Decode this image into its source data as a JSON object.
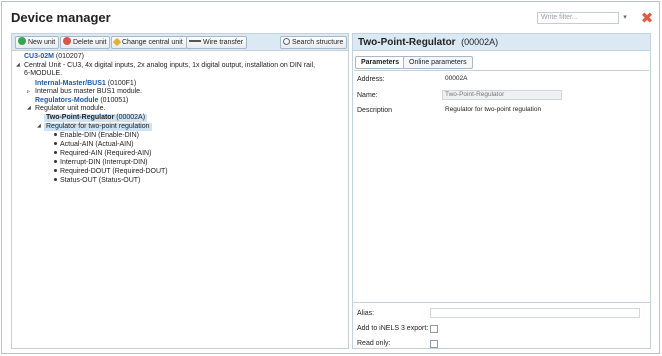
{
  "window": {
    "title": "Device manager",
    "filter_placeholder": "Write filter...",
    "filter_dropdown_icon": "chevron-down-icon",
    "close_icon": "close-icon",
    "close_glyph": "✖"
  },
  "toolbar": {
    "new_unit": "New unit",
    "delete_unit": "Delete unit",
    "change_central_unit": "Change central unit",
    "wire_transfer": "Wire transfer",
    "search_structure": "Search structure"
  },
  "tree": {
    "root": {
      "name": "CU3-02M",
      "code": "(010207)"
    },
    "root_desc_line1": "Central Unit - CU3, 4x digital inputs, 2x analog inputs, 1x digital output, installation on DIN rail,",
    "root_desc_line2": "6-MODULE.",
    "bus": {
      "name": "Internal-Master/BUS1",
      "code": "(0100F1)",
      "desc": "Internal bus master BUS1 module."
    },
    "module": {
      "name": "Regulators-Module",
      "code": "(010051)",
      "desc": "Regulator unit module."
    },
    "regulator": {
      "name": "Two-Point-Regulator",
      "code": "(00002A)",
      "desc": "Regulator for two-point regulation"
    },
    "signals": [
      "Enable-DIN (Enable-DIN)",
      "Actual-AIN (Actual-AIN)",
      "Required-AIN (Required-AIN)",
      "Interrupt-DIN (Interrupt-DIN)",
      "Required-DOUT (Required-DOUT)",
      "Status-OUT (Status-OUT)"
    ]
  },
  "detail": {
    "title": "Two-Point-Regulator",
    "code": "(00002A)",
    "tabs": [
      "Parameters",
      "Online parameters"
    ],
    "address_label": "Address:",
    "address_value": "00002A",
    "name_label": "Name:",
    "name_value": "Two-Point-Regulator",
    "description_label": "Description",
    "description_value": "Regulator for two-point regulation",
    "alias_label": "Alias:",
    "alias_value": "",
    "export_label": "Add to iNELS 3 export:",
    "export_checked": false,
    "readonly_label": "Read only:",
    "readonly_checked": false
  },
  "colors": {
    "header_bg": "#dbe9f5",
    "link_blue": "#1d5aa8",
    "selected_bg": "#cde4f7",
    "close_red": "#e05a42"
  }
}
